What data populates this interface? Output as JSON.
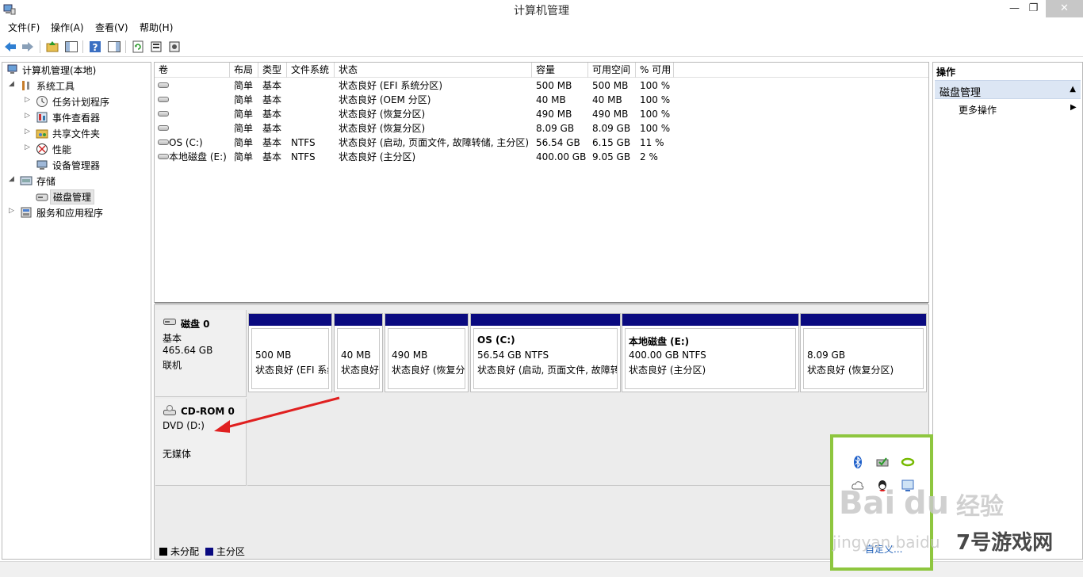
{
  "window": {
    "title": "计算机管理",
    "controls": {
      "minimize": "—",
      "maximize": "❐",
      "close": "✕"
    }
  },
  "menu": [
    "文件(F)",
    "操作(A)",
    "查看(V)",
    "帮助(H)"
  ],
  "toolbar": {
    "icons": [
      "back-arrow-icon",
      "forward-arrow-icon",
      "up-folder-icon",
      "show-hide-tree-icon",
      "help-icon",
      "show-hide-action-pane-icon",
      "refresh-icon",
      "properties-icon",
      "export-icon"
    ]
  },
  "tree": {
    "root": "计算机管理(本地)",
    "system_tools": "系统工具",
    "task_scheduler": "任务计划程序",
    "event_viewer": "事件查看器",
    "shared_folders": "共享文件夹",
    "performance": "性能",
    "device_manager": "设备管理器",
    "storage": "存储",
    "disk_management": "磁盘管理",
    "services_apps": "服务和应用程序"
  },
  "volumes": {
    "headers": [
      "卷",
      "布局",
      "类型",
      "文件系统",
      "状态",
      "容量",
      "可用空间",
      "% 可用"
    ],
    "rows": [
      {
        "name": "",
        "layout": "简单",
        "type": "基本",
        "fs": "",
        "status": "状态良好 (EFI 系统分区)",
        "capacity": "500 MB",
        "free": "500 MB",
        "pct": "100 %"
      },
      {
        "name": "",
        "layout": "简单",
        "type": "基本",
        "fs": "",
        "status": "状态良好 (OEM 分区)",
        "capacity": "40 MB",
        "free": "40 MB",
        "pct": "100 %"
      },
      {
        "name": "",
        "layout": "简单",
        "type": "基本",
        "fs": "",
        "status": "状态良好 (恢复分区)",
        "capacity": "490 MB",
        "free": "490 MB",
        "pct": "100 %"
      },
      {
        "name": "",
        "layout": "简单",
        "type": "基本",
        "fs": "",
        "status": "状态良好 (恢复分区)",
        "capacity": "8.09 GB",
        "free": "8.09 GB",
        "pct": "100 %"
      },
      {
        "name": "OS (C:)",
        "layout": "简单",
        "type": "基本",
        "fs": "NTFS",
        "status": "状态良好 (启动, 页面文件, 故障转储, 主分区)",
        "capacity": "56.54 GB",
        "free": "6.15 GB",
        "pct": "11 %"
      },
      {
        "name": "本地磁盘 (E:)",
        "layout": "简单",
        "type": "基本",
        "fs": "NTFS",
        "status": "状态良好 (主分区)",
        "capacity": "400.00 GB",
        "free": "9.05 GB",
        "pct": "2 %"
      }
    ]
  },
  "disk0": {
    "name": "磁盘 0",
    "type": "基本",
    "size": "465.64 GB",
    "state": "联机",
    "partitions": [
      {
        "title": "",
        "size": "500 MB",
        "status": "状态良好 (EFI 系统"
      },
      {
        "title": "",
        "size": "40 MB",
        "status": "状态良好"
      },
      {
        "title": "",
        "size": "490 MB",
        "status": "状态良好 (恢复分"
      },
      {
        "title": "OS  (C:)",
        "size": "56.54 GB NTFS",
        "status": "状态良好 (启动, 页面文件, 故障转"
      },
      {
        "title": "本地磁盘  (E:)",
        "size": "400.00 GB NTFS",
        "status": "状态良好 (主分区)"
      },
      {
        "title": "",
        "size": "8.09 GB",
        "status": "状态良好 (恢复分区)"
      }
    ]
  },
  "cdrom": {
    "name": "CD-ROM 0",
    "drive": "DVD (D:)",
    "media": "无媒体"
  },
  "legend": {
    "unallocated": "未分配",
    "primary": "主分区",
    "colors": {
      "unallocated": "#000000",
      "primary": "#0a0a80"
    }
  },
  "actions": {
    "title": "操作",
    "section": "磁盘管理",
    "more": "更多操作"
  },
  "tray": {
    "customize": "自定义...",
    "icons": [
      "bluetooth-icon",
      "network-check-icon",
      "nvidia-icon",
      "cloud-icon",
      "qq-icon",
      "monitor-icon"
    ]
  },
  "watermarks": {
    "baidu": "Bai",
    "du": "du",
    "jingyan": "经验",
    "url": "jingyan.baidu",
    "site": "7号游戏网"
  },
  "colors": {
    "accent_bar": "#0a0a80",
    "action_header": "#dce6f4",
    "tray_border": "#8ec63f",
    "annotation": "#e02020"
  }
}
